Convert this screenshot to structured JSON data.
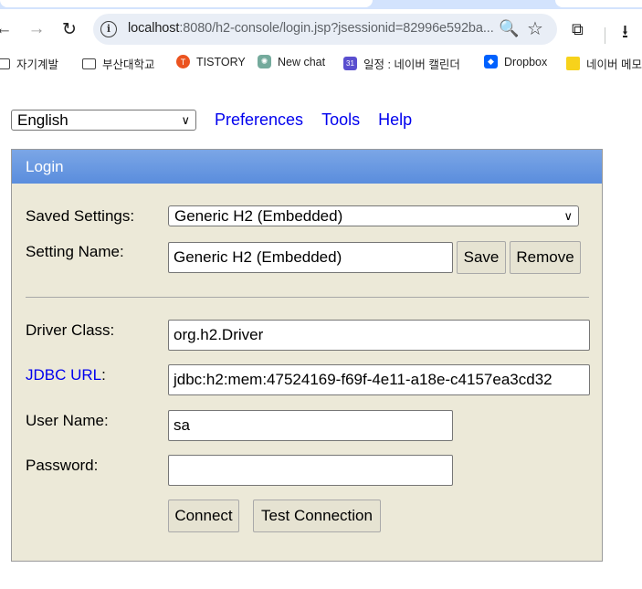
{
  "browser": {
    "url_host": "localhost",
    "url_rest": ":8080/h2-console/login.jsp?jsessionid=82996e592ba...",
    "back_icon": "←",
    "forward_icon": "→",
    "reload_icon": "↻",
    "zoom_icon": "🔍",
    "star_icon": "☆",
    "extensions_icon": "⧉",
    "download_icon": "⭳"
  },
  "bookmarks": [
    {
      "label": "자기계발",
      "icon": "folder-icon"
    },
    {
      "label": "부산대학교",
      "icon": "folder-icon"
    },
    {
      "label": "TISTORY",
      "icon": "tistory-icon",
      "color": "#eb531f"
    },
    {
      "label": "New chat",
      "icon": "chatgpt-icon",
      "color": "#74aa9c"
    },
    {
      "label": "일정 : 네이버 캘린더",
      "icon": "calendar-icon",
      "color": "#5a4fcf",
      "badge": "31"
    },
    {
      "label": "Dropbox",
      "icon": "dropbox-icon",
      "color": "#0061fe"
    },
    {
      "label": "네이버 메모",
      "icon": "memo-icon",
      "color": "#f7d21b"
    }
  ],
  "topbar": {
    "language": "English",
    "links": [
      "Preferences",
      "Tools",
      "Help"
    ]
  },
  "login": {
    "title": "Login",
    "saved_settings_label": "Saved Settings:",
    "saved_settings_value": "Generic H2 (Embedded)",
    "setting_name_label": "Setting Name:",
    "setting_name_value": "Generic H2 (Embedded)",
    "save_label": "Save",
    "remove_label": "Remove",
    "driver_class_label": "Driver Class:",
    "driver_class_value": "org.h2.Driver",
    "jdbc_url_link": "JDBC URL",
    "jdbc_url_suffix": ":",
    "jdbc_url_value": "jdbc:h2:mem:47524169-f69f-4e11-a18e-c4157ea3cd32",
    "user_name_label": "User Name:",
    "user_name_value": "sa",
    "password_label": "Password:",
    "password_value": "",
    "connect_label": "Connect",
    "test_connection_label": "Test Connection"
  },
  "colors": {
    "panel_bg": "#ece9d8",
    "header_blue": "#5a8ddd",
    "link_blue": "#0000ee"
  }
}
